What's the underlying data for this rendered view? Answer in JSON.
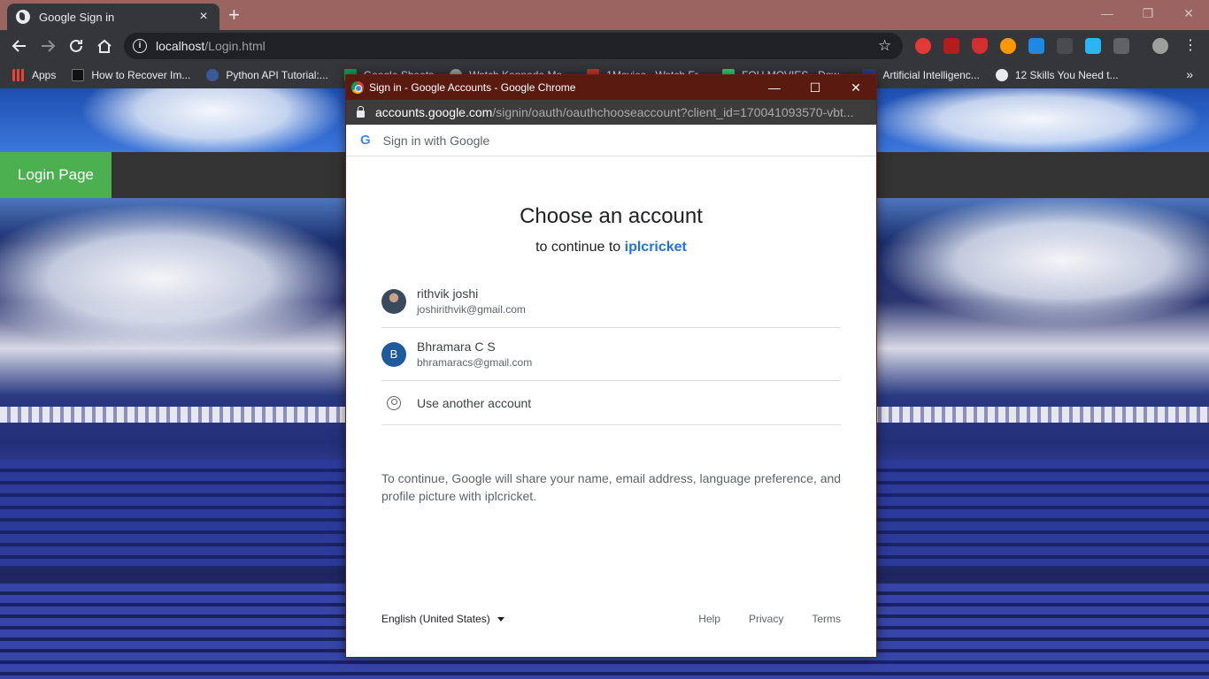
{
  "browser": {
    "tab_title": "Google Sign in",
    "tab_close": "×",
    "new_tab": "+",
    "url_host": "localhost",
    "url_path": "/Login.html",
    "window_minimize": "—",
    "window_restore": "❐",
    "window_close": "✕",
    "bookmarks": [
      {
        "label": "Apps",
        "color": "#f4b400"
      },
      {
        "label": "How to Recover Im...",
        "color": "#111111"
      },
      {
        "label": "Python API Tutorial:...",
        "color": "#3b5998"
      },
      {
        "label": "Google Sheets",
        "color": "#0f9d58"
      },
      {
        "label": "Watch Kannada Mo...",
        "color": "#9aa0a6"
      },
      {
        "label": "1Movies - Watch Fr...",
        "color": "#c0392b"
      },
      {
        "label": "FOU MOVIES - Dow...",
        "color": "#2ecc71"
      },
      {
        "label": "Artificial Intelligenc...",
        "color": "#2e3a8c"
      },
      {
        "label": "12 Skills You Need t...",
        "color": "#e8eaed"
      }
    ],
    "bookmarks_more": "»"
  },
  "page": {
    "nav_login": "Login Page"
  },
  "popup": {
    "window_title": "Sign in - Google Accounts - Google Chrome",
    "minimize": "—",
    "maximize": "☐",
    "close": "✕",
    "url_host": "accounts.google.com",
    "url_path": "/signin/oauth/oauthchooseaccount?client_id=170041093570-vbt...",
    "header_logo": "G",
    "header_text": "Sign in with Google",
    "title": "Choose an account",
    "continue_prefix": "to continue to",
    "app_name": "iplcricket",
    "accounts": [
      {
        "name": "rithvik joshi",
        "email": "joshirithvik@gmail.com",
        "avatar": ""
      },
      {
        "name": "Bhramara C S",
        "email": "bhramaracs@gmail.com",
        "avatar": "B"
      }
    ],
    "use_another": "Use another account",
    "disclaimer": "To continue, Google will share your name, email address, language preference, and profile picture with iplcricket.",
    "language": "English (United States)",
    "footer_links": [
      "Help",
      "Privacy",
      "Terms"
    ]
  }
}
